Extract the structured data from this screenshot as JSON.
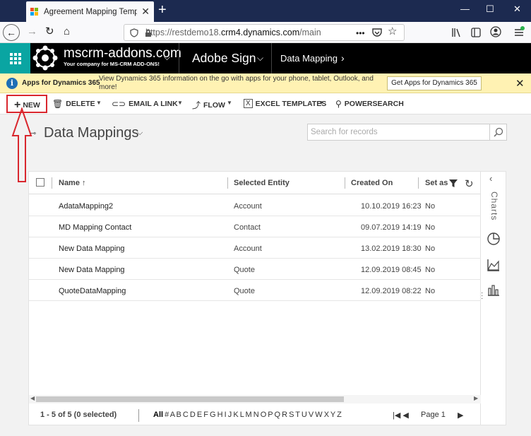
{
  "browser": {
    "tab_title": "Agreement Mapping Template",
    "tab_close": "✕",
    "new_tab": "+",
    "url_prefix": "https://restdemo18.",
    "url_domain": "crm4.dynamics.com",
    "url_suffix": "/main.asp",
    "url_more": "•••",
    "win_min": "—",
    "win_max": "☐",
    "win_close": "✕"
  },
  "crm_header": {
    "brand_name": "mscrm-addons.com",
    "brand_tagline": "Your company for MS-CRM ADD-ONS!",
    "app_name": "Adobe Sign",
    "entity_name": "Data Mapping"
  },
  "notification": {
    "title": "Apps for Dynamics 365",
    "message": "View Dynamics 365 information on the go with apps for your phone, tablet, Outlook, and more!",
    "button": "Get Apps for Dynamics 365"
  },
  "commands": {
    "new": "NEW",
    "delete": "DELETE",
    "email_link": "EMAIL A LINK",
    "flow": "FLOW",
    "excel_templates": "EXCEL TEMPLATES",
    "powersearch": "POWERSEARCH"
  },
  "view": {
    "title": "Data Mappings",
    "search_placeholder": "Search for records"
  },
  "grid": {
    "columns": {
      "name": "Name ↑",
      "entity": "Selected Entity",
      "created": "Created On",
      "setas": "Set as"
    },
    "rows": [
      {
        "name": "AdataMapping2",
        "entity": "Account",
        "created": "10.10.2019 16:23",
        "setas": "No"
      },
      {
        "name": "MD Mapping Contact",
        "entity": "Contact",
        "created": "09.07.2019 14:19",
        "setas": "No"
      },
      {
        "name": "New Data Mapping",
        "entity": "Account",
        "created": "13.02.2019 18:30",
        "setas": "No"
      },
      {
        "name": "New Data Mapping",
        "entity": "Quote",
        "created": "12.09.2019 08:45",
        "setas": "No"
      },
      {
        "name": "QuoteDataMapping",
        "entity": "Quote",
        "created": "12.09.2019 08:22",
        "setas": "No"
      }
    ]
  },
  "pager": {
    "status": "1 - 5 of 5 (0 selected)",
    "alpha_all": "All",
    "alpha_letters": "# A B C D E F G H I J K L M N O P Q R S T U V W X Y Z",
    "page_label": "Page 1"
  },
  "side_panel": {
    "label": "Charts"
  },
  "colors": {
    "tabbar": "#1c2a50",
    "waffle": "#0aa5a2",
    "notification_bg": "#fff2b3",
    "highlight_red": "#d9272e"
  }
}
